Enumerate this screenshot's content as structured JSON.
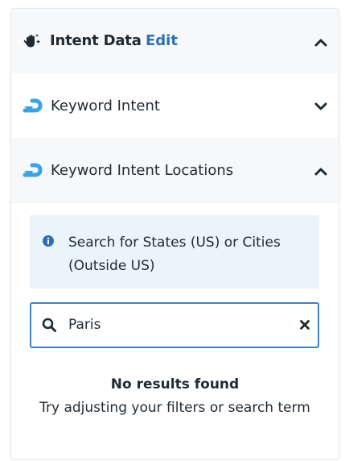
{
  "header": {
    "icon": "hand-pointer-sparkle-icon",
    "title": "Intent Data",
    "edit_label": "Edit",
    "chevron": "chevron-up-icon"
  },
  "sections": [
    {
      "icon": "curved-arrow-icon",
      "label": "Keyword Intent",
      "chevron": "chevron-down-icon",
      "expanded": false
    },
    {
      "icon": "curved-arrow-icon",
      "label": "Keyword Intent Locations",
      "chevron": "chevron-up-icon",
      "expanded": true
    }
  ],
  "info": {
    "icon": "info-circle-icon",
    "text": "Search for States (US) or Cities (Outside US)"
  },
  "search": {
    "value": "Paris",
    "icon": "search-icon",
    "clear_icon": "close-icon"
  },
  "empty_state": {
    "title": "No results found",
    "message": "Try adjusting your filters or search term"
  },
  "colors": {
    "accent": "#2d6fb4",
    "icon_blue": "#3aa3e3",
    "info_bg": "#ebf3fb",
    "header_bg": "#f6f8f9",
    "input_border": "#3b82c4"
  }
}
